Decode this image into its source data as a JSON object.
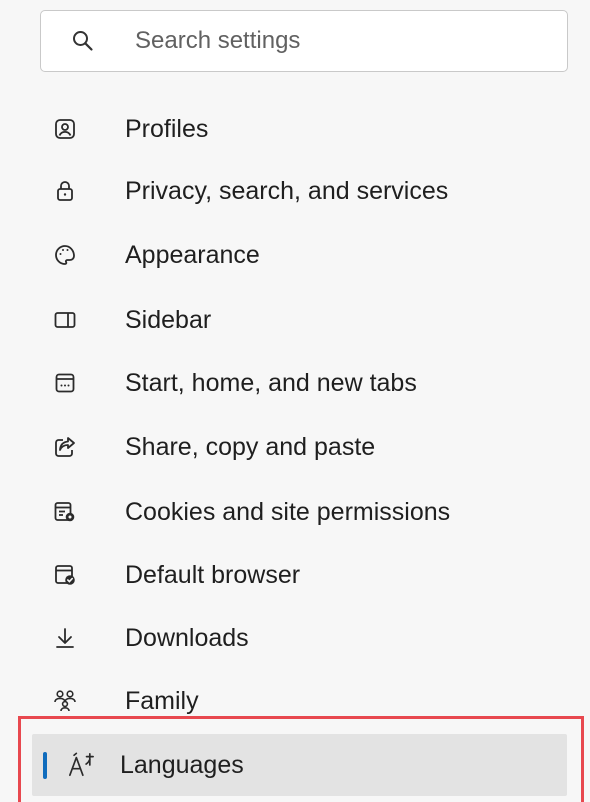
{
  "search": {
    "placeholder": "Search settings",
    "icon": "search-icon"
  },
  "sidebar": {
    "items": [
      {
        "label": "Profiles",
        "icon": "profile-icon"
      },
      {
        "label": "Privacy, search, and services",
        "icon": "lock-icon"
      },
      {
        "label": "Appearance",
        "icon": "palette-icon"
      },
      {
        "label": "Sidebar",
        "icon": "sidebar-icon"
      },
      {
        "label": "Start, home, and new tabs",
        "icon": "home-tabs-icon"
      },
      {
        "label": "Share, copy and paste",
        "icon": "share-icon"
      },
      {
        "label": "Cookies and site permissions",
        "icon": "cookies-permissions-icon"
      },
      {
        "label": "Default browser",
        "icon": "default-browser-icon"
      },
      {
        "label": "Downloads",
        "icon": "download-icon"
      },
      {
        "label": "Family",
        "icon": "family-icon"
      },
      {
        "label": "Languages",
        "icon": "languages-icon",
        "selected": true
      }
    ]
  },
  "colors": {
    "accent": "#0f6cbd",
    "highlight_outline": "#e8484f",
    "selected_background": "#e3e3e3"
  }
}
